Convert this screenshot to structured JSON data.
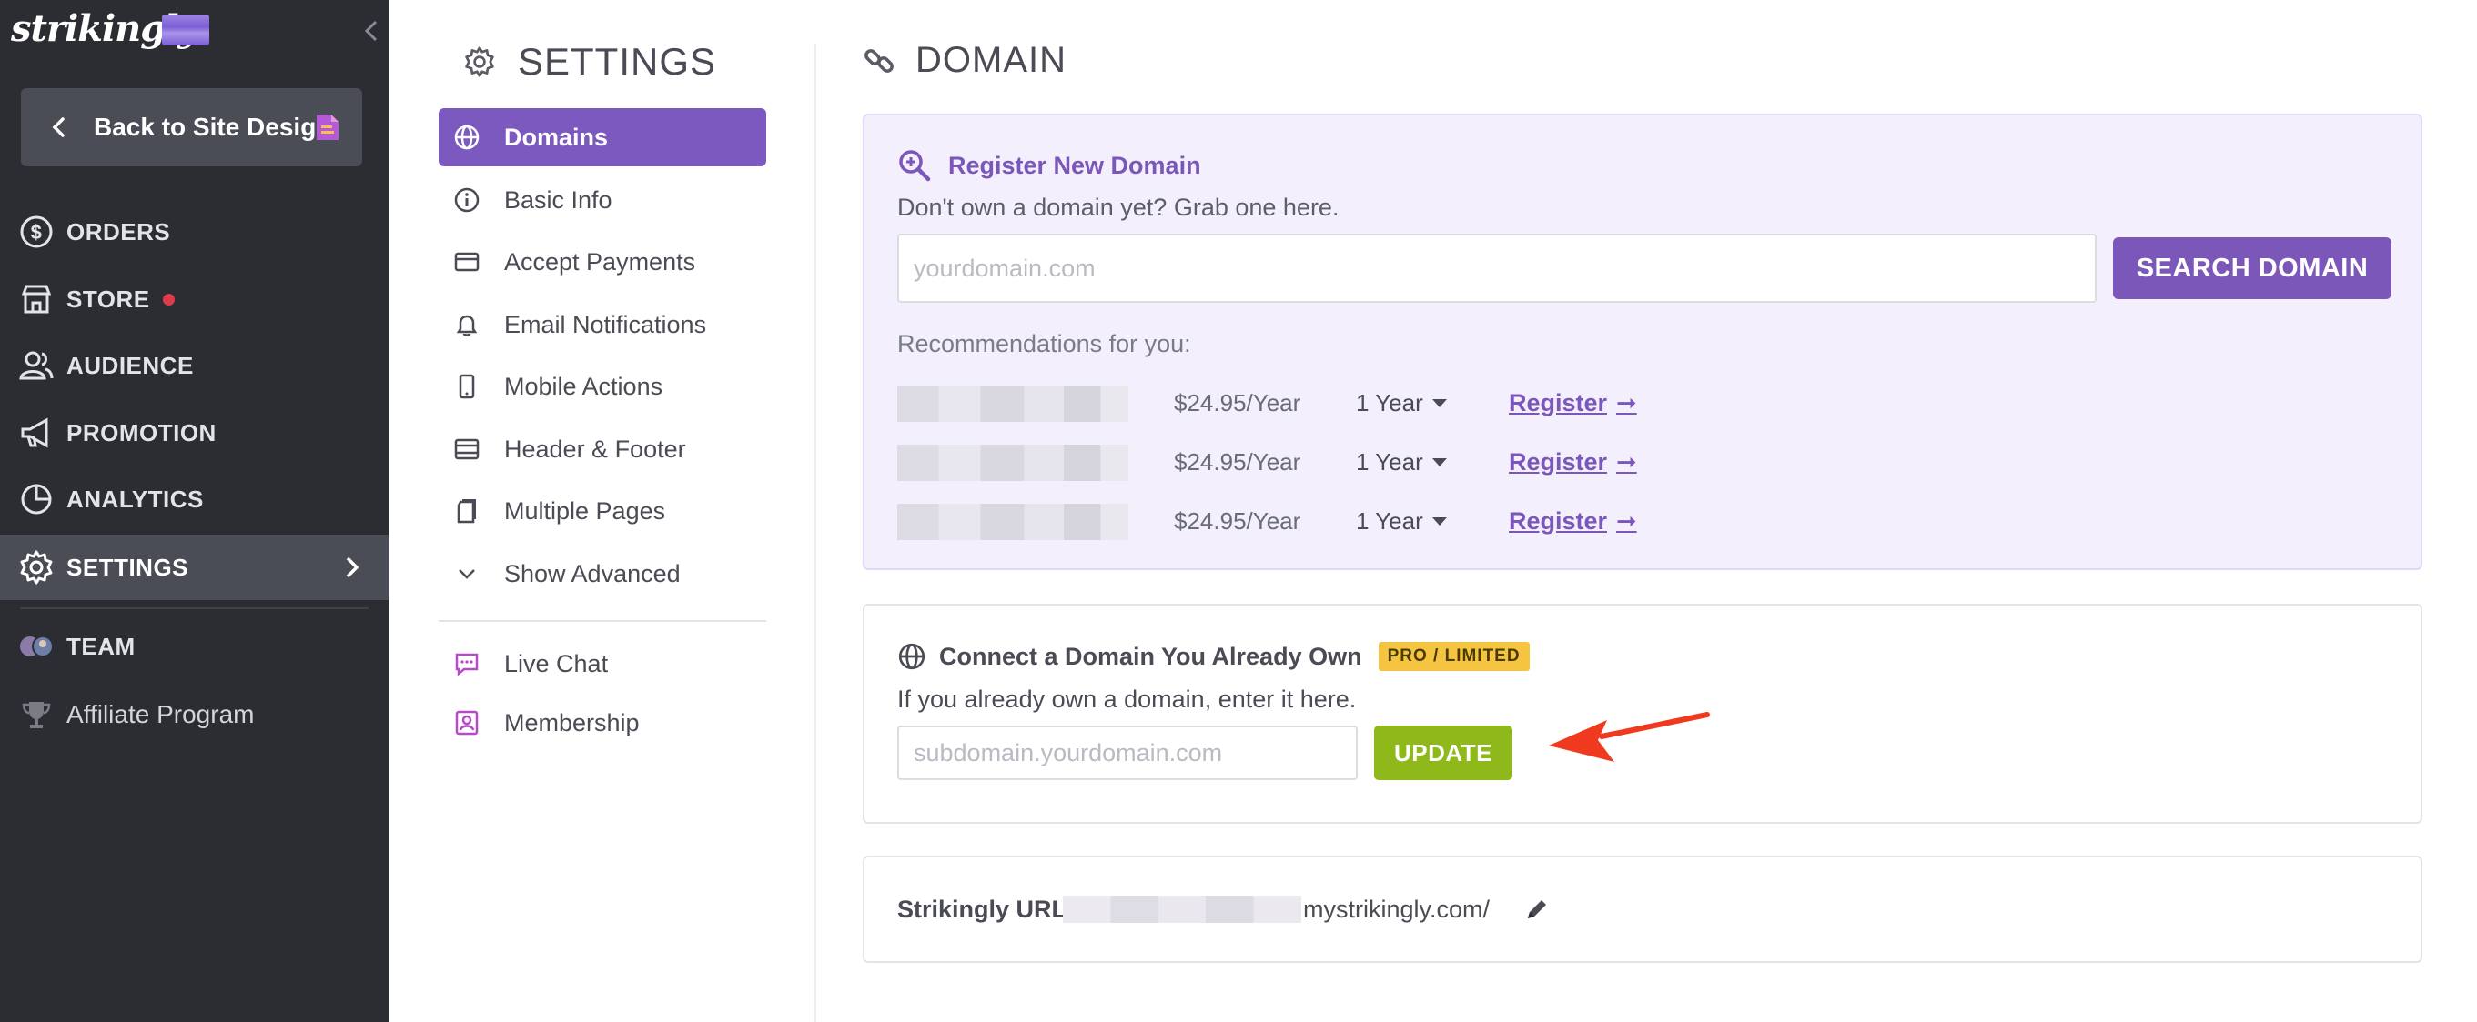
{
  "app": {
    "logo_text": "strikingly"
  },
  "sidebar": {
    "back_label": "Back to Site Design",
    "items": [
      {
        "label": "ORDERS",
        "icon": "dollar-circle-icon"
      },
      {
        "label": "STORE",
        "icon": "storefront-icon",
        "has_notification": true
      },
      {
        "label": "AUDIENCE",
        "icon": "users-icon"
      },
      {
        "label": "PROMOTION",
        "icon": "megaphone-icon"
      },
      {
        "label": "ANALYTICS",
        "icon": "pie-chart-icon"
      },
      {
        "label": "SETTINGS",
        "icon": "gear-icon",
        "active": true
      },
      {
        "label": "TEAM",
        "icon": "team-avatars-icon"
      },
      {
        "label": "Affiliate Program",
        "icon": "trophy-icon"
      }
    ]
  },
  "settings": {
    "title": "SETTINGS",
    "items": [
      {
        "label": "Domains",
        "icon": "globe-icon",
        "active": true
      },
      {
        "label": "Basic Info",
        "icon": "info-icon"
      },
      {
        "label": "Accept Payments",
        "icon": "card-icon"
      },
      {
        "label": "Email Notifications",
        "icon": "bell-icon"
      },
      {
        "label": "Mobile Actions",
        "icon": "mobile-icon"
      },
      {
        "label": "Header & Footer",
        "icon": "header-footer-icon"
      },
      {
        "label": "Multiple Pages",
        "icon": "pages-icon"
      },
      {
        "label": "Show Advanced",
        "icon": "chevron-down-icon"
      }
    ],
    "extras": [
      {
        "label": "Live Chat",
        "icon": "chat-icon"
      },
      {
        "label": "Membership",
        "icon": "membership-icon"
      }
    ]
  },
  "domain": {
    "title": "DOMAIN",
    "register": {
      "title": "Register New Domain",
      "subtitle": "Don't own a domain yet? Grab one here.",
      "placeholder": "yourdomain.com",
      "search_button": "SEARCH DOMAIN",
      "recommendations_label": "Recommendations for you:",
      "recommendations": [
        {
          "price": "$24.95/Year",
          "term": "1 Year",
          "action": "Register"
        },
        {
          "price": "$24.95/Year",
          "term": "1 Year",
          "action": "Register"
        },
        {
          "price": "$24.95/Year",
          "term": "1 Year",
          "action": "Register"
        }
      ],
      "arrow_glyph": "➞"
    },
    "connect": {
      "title": "Connect a Domain You Already Own",
      "badge": "PRO / LIMITED",
      "subtitle": "If you already own a domain, enter it here.",
      "placeholder": "subdomain.yourdomain.com",
      "update_button": "UPDATE"
    },
    "strikingly_url": {
      "label": "Strikingly URL:",
      "suffix": "mystrikingly.com/"
    }
  },
  "colors": {
    "sidebar_bg": "#2b2d32",
    "accent_purple": "#7b57b9",
    "update_green": "#8fb81a",
    "badge_yellow": "#f5c542",
    "annotation_red": "#f03a1f"
  }
}
